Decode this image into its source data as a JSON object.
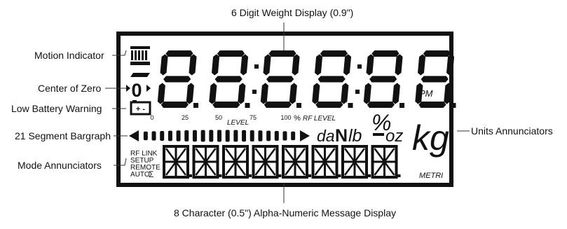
{
  "colors": {
    "background": "#ffffff",
    "bezel": "#111111",
    "lcd_face": "#ffffff",
    "segment": "#111111",
    "leader_line": "#333333"
  },
  "callouts": {
    "weight_display": "6 Digit Weight Display (0.9\")",
    "motion_indicator": "Motion Indicator",
    "center_of_zero": "Center of Zero",
    "low_battery": "Low Battery Warning",
    "bargraph": "21 Segment Bargraph",
    "mode_annunciators": "Mode Annunciators",
    "units_annunciators": "Units Annunciators",
    "message_display": "8 Character (0.5\") Alpha-Numeric Message Display"
  },
  "lcd": {
    "digit_count": 6,
    "digit_glyph": "8.",
    "pm_label": "PM",
    "zero_symbol": "0",
    "battery_symbol": "+ -",
    "scale_ticks": [
      "0",
      "25",
      "50",
      "75",
      "100"
    ],
    "scale_percent": "%",
    "level_label": "LEVEL",
    "rf_level_label": "RF LEVEL",
    "bargraph_segments": 21,
    "units": {
      "da": "da",
      "N": "N",
      "lb": "lb",
      "percent": "%",
      "oz": "oz",
      "kg": "kg",
      "metric": "METRI"
    },
    "modes": [
      "RF LINK",
      "SETUP",
      "REMOTE",
      "AUTO",
      "Σ"
    ],
    "message_char_count": 8
  }
}
